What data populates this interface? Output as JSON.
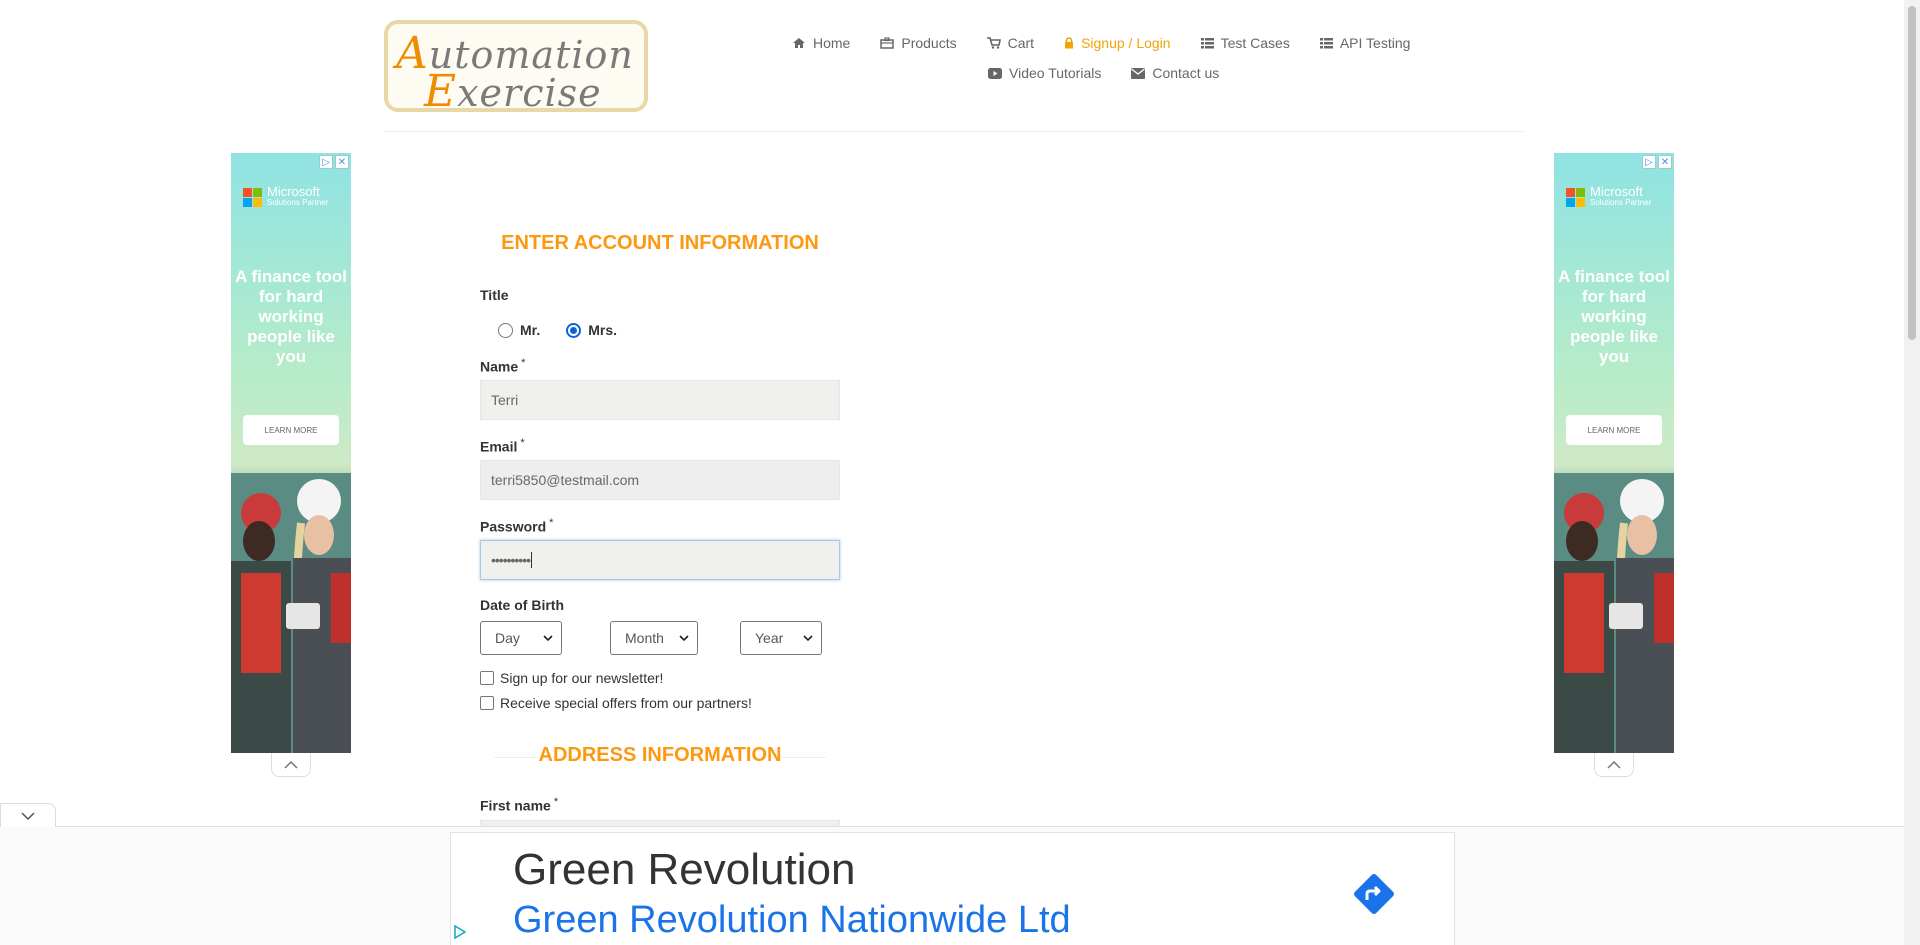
{
  "brand": {
    "logo_line1": "Automation",
    "logo_line2": "Exercise"
  },
  "nav": {
    "row1": [
      {
        "label": "Home",
        "icon": "home-icon",
        "active": false
      },
      {
        "label": "Products",
        "icon": "products-icon",
        "active": false
      },
      {
        "label": "Cart",
        "icon": "cart-icon",
        "active": false
      },
      {
        "label": "Signup / Login",
        "icon": "lock-icon",
        "active": true
      },
      {
        "label": "Test Cases",
        "icon": "list-icon",
        "active": false
      },
      {
        "label": "API Testing",
        "icon": "list-icon",
        "active": false
      }
    ],
    "row2": [
      {
        "label": "Video Tutorials",
        "icon": "youtube-icon",
        "active": false
      },
      {
        "label": "Contact us",
        "icon": "envelope-icon",
        "active": false
      }
    ],
    "active_color": "#f0a30a"
  },
  "side_ad": {
    "brand": "Microsoft",
    "brand_sub": "Solutions Partner",
    "tagline": "A finance tool for hard working people like you",
    "button": "LEARN MORE"
  },
  "form": {
    "section_title": "ENTER ACCOUNT INFORMATION",
    "title_label": "Title",
    "title_options": [
      {
        "label": "Mr.",
        "selected": false
      },
      {
        "label": "Mrs.",
        "selected": true
      }
    ],
    "name_label": "Name",
    "name_value": "Terri",
    "email_label": "Email",
    "email_value": "terri5850@testmail.com",
    "password_label": "Password",
    "password_value": "••••••••••",
    "required_mark": "*",
    "dob_label": "Date of Birth",
    "dob_day": "Day",
    "dob_month": "Month",
    "dob_year": "Year",
    "newsletter_label": "Sign up for our newsletter!",
    "offers_label": "Receive special offers from our partners!",
    "address_title": "ADDRESS INFORMATION",
    "first_name_label": "First name",
    "accent_color": "#fe980f"
  },
  "bottom_ad": {
    "headline": "Green Revolution",
    "advertiser": "Green Revolution Nationwide Ltd"
  }
}
